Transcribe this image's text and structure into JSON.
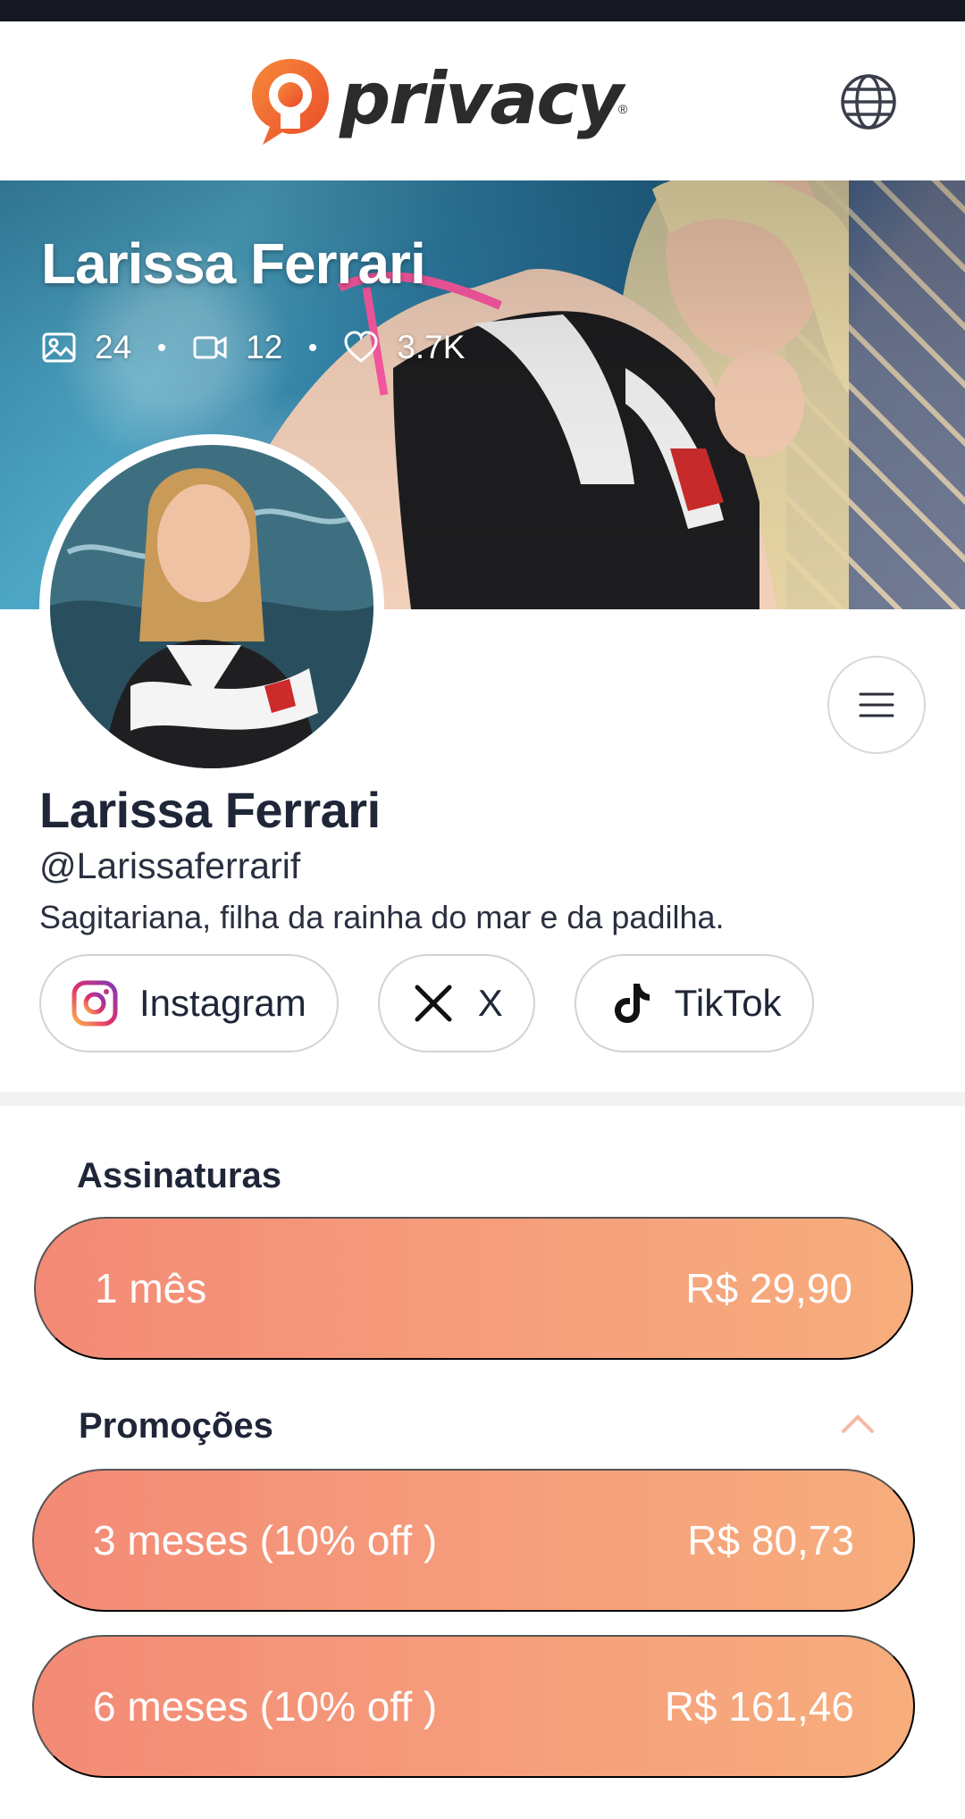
{
  "brand": {
    "name": "privacy",
    "reg_mark": "®",
    "accent": "#f26a3d"
  },
  "icons": {
    "globe": "globe-icon",
    "menu": "hamburger-menu-icon",
    "photos": "image-icon",
    "videos": "video-icon",
    "likes": "heart-icon"
  },
  "cover": {
    "name": "Larissa Ferrari",
    "stats": {
      "photos": "24",
      "videos": "12",
      "likes": "3.7K"
    }
  },
  "profile": {
    "name": "Larissa Ferrari",
    "handle": "@Larissaferrarif",
    "bio": "Sagitariana, filha da rainha do mar e da padilha."
  },
  "socials": [
    {
      "label": "Instagram",
      "icon": "instagram-icon"
    },
    {
      "label": "X",
      "icon": "x-icon"
    },
    {
      "label": "TikTok",
      "icon": "tiktok-icon"
    }
  ],
  "subscriptions": {
    "title": "Assinaturas",
    "plans": [
      {
        "label": "1 mês",
        "price": "R$ 29,90"
      }
    ]
  },
  "promotions": {
    "title": "Promoções",
    "expanded": true,
    "plans": [
      {
        "label": "3 meses (10% off )",
        "price": "R$ 80,73"
      },
      {
        "label": "6 meses (10% off )",
        "price": "R$ 161,46"
      }
    ]
  },
  "colors": {
    "plan_gradient_start": "#f38a76",
    "plan_gradient_end": "#f7ad7c",
    "text_dark": "#1f2638"
  }
}
